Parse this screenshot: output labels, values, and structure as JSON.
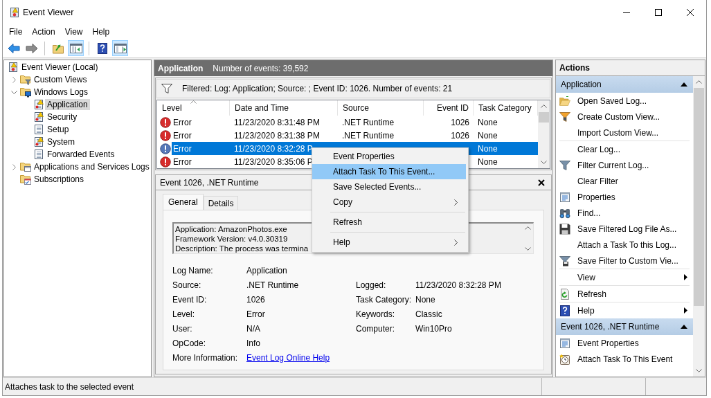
{
  "window": {
    "title": "Event Viewer"
  },
  "menu_bar": [
    "File",
    "Action",
    "View",
    "Help"
  ],
  "toolbar": [
    [
      {
        "kind": "back",
        "disabled": false,
        "pressed": false
      },
      {
        "kind": "forward",
        "disabled": true,
        "pressed": false
      }
    ],
    [
      {
        "kind": "up",
        "disabled": false,
        "pressed": false
      },
      {
        "kind": "console_tree",
        "disabled": false,
        "pressed": true
      }
    ],
    [
      {
        "kind": "help",
        "disabled": false,
        "pressed": false
      },
      {
        "kind": "action_pane",
        "disabled": false,
        "pressed": true
      }
    ]
  ],
  "console_tree": [
    {
      "label": "Event Viewer (Local)",
      "kind": "root",
      "selected": false,
      "children": [
        {
          "label": "Custom Views",
          "kind": "filter_folder",
          "expanded": false,
          "selected": false
        },
        {
          "label": "Windows Logs",
          "kind": "windows_folder",
          "expanded": true,
          "selected": false,
          "children": [
            {
              "label": "Application",
              "kind": "log_warning",
              "selected": true
            },
            {
              "label": "Security",
              "kind": "log_warning",
              "selected": false
            },
            {
              "label": "Setup",
              "kind": "log",
              "selected": false
            },
            {
              "label": "System",
              "kind": "log_warning",
              "selected": false
            },
            {
              "label": "Forwarded Events",
              "kind": "log",
              "selected": false
            }
          ]
        },
        {
          "label": "Applications and Services Logs",
          "kind": "folder",
          "expanded": false,
          "selected": false
        },
        {
          "label": "Subscriptions",
          "kind": "subscriptions",
          "selected": false
        }
      ]
    }
  ],
  "log_header": {
    "title": "Application",
    "event_count": "Number of events: 39,592"
  },
  "filter_bar": {
    "text": "Filtered: Log: Application; Source: ; Event ID: 1026. Number of events: 21"
  },
  "events_table": {
    "columns": [
      {
        "label": "Level",
        "sorted": true
      },
      {
        "label": "Date and Time",
        "sorted": false
      },
      {
        "label": "Source",
        "sorted": false
      },
      {
        "label": "Event ID",
        "sorted": false
      },
      {
        "label": "Task Category",
        "sorted": false
      }
    ],
    "rows": [
      {
        "kind": "error",
        "level": "Error",
        "date_time": "11/23/2020 8:31:48 PM",
        "source": ".NET Runtime",
        "event_id": "1026",
        "task_category": "None",
        "selected": false
      },
      {
        "kind": "error",
        "level": "Error",
        "date_time": "11/23/2020 8:31:38 PM",
        "source": ".NET Runtime",
        "event_id": "1026",
        "task_category": "None",
        "selected": false
      },
      {
        "kind": "error",
        "level": "Error",
        "date_time": "11/23/2020 8:32:28 P",
        "task_category": "None",
        "selected": true
      },
      {
        "kind": "error",
        "level": "Error",
        "date_time": "11/23/2020 8:35:06 P",
        "task_category": "None",
        "selected": false
      }
    ]
  },
  "event_details": {
    "title": "Event 1026, .NET Runtime",
    "tabs": [
      {
        "label": "General",
        "selected": true
      },
      {
        "label": "Details",
        "selected": false
      }
    ],
    "description": "Application: AmazonPhotos.exe\nFramework Version: v4.0.30319\nDescription: The process was termina",
    "properties": [
      {
        "left": {
          "label": "Log Name:",
          "value": "Application"
        }
      },
      {
        "left": {
          "label": "Source:",
          "value": ".NET Runtime"
        },
        "right": {
          "label": "Logged:",
          "value": "11/23/2020 8:32:28 PM"
        }
      },
      {
        "left": {
          "label": "Event ID:",
          "value": "1026"
        },
        "right": {
          "label": "Task Category:",
          "value": "None"
        }
      },
      {
        "left": {
          "label": "Level:",
          "value": "Error"
        },
        "right": {
          "label": "Keywords:",
          "value": "Classic"
        }
      },
      {
        "left": {
          "label": "User:",
          "value": "N/A"
        },
        "right": {
          "label": "Computer:",
          "value": "Win10Pro"
        }
      },
      {
        "left": {
          "label": "OpCode:",
          "value": "Info"
        }
      },
      {
        "left": {
          "label": "More Information:",
          "link": "Event Log Online Help"
        }
      }
    ]
  },
  "context_menu": {
    "groups": [
      [
        {
          "label": "Event Properties",
          "selected": false,
          "submenu": false
        },
        {
          "label": "Attach Task To This Event...",
          "selected": true,
          "submenu": false
        },
        {
          "label": "Save Selected Events...",
          "selected": false,
          "submenu": false
        },
        {
          "label": "Copy",
          "selected": false,
          "submenu": true
        }
      ],
      [
        {
          "label": "Refresh",
          "selected": false,
          "submenu": false
        }
      ],
      [
        {
          "label": "Help",
          "selected": false,
          "submenu": true
        }
      ]
    ]
  },
  "actions_pane": {
    "title": "Actions",
    "sections": [
      {
        "title": "Application",
        "expanded": true,
        "groups": [
          [
            {
              "label": "Open Saved Log...",
              "kind": "open_log",
              "submenu": false
            },
            {
              "label": "Create Custom View...",
              "kind": "create_view",
              "submenu": false
            },
            {
              "label": "Import Custom View...",
              "kind": "plain",
              "submenu": false
            }
          ],
          [
            {
              "label": "Clear Log...",
              "kind": "plain",
              "submenu": false
            },
            {
              "label": "Filter Current Log...",
              "kind": "filter",
              "submenu": false
            },
            {
              "label": "Clear Filter",
              "kind": "plain",
              "submenu": false
            },
            {
              "label": "Properties",
              "kind": "properties",
              "submenu": false
            },
            {
              "label": "Find...",
              "kind": "find",
              "submenu": false
            },
            {
              "label": "Save Filtered Log File As...",
              "kind": "save",
              "submenu": false
            },
            {
              "label": "Attach a Task To this Log...",
              "kind": "plain",
              "submenu": false
            },
            {
              "label": "Save Filter to Custom Vie...",
              "kind": "save_filter",
              "submenu": false
            }
          ],
          [
            {
              "label": "View",
              "kind": "plain",
              "submenu": true
            }
          ],
          [
            {
              "label": "Refresh",
              "kind": "refresh",
              "submenu": false
            }
          ],
          [
            {
              "label": "Help",
              "kind": "help",
              "submenu": true
            }
          ]
        ]
      },
      {
        "title": "Event 1026, .NET Runtime",
        "expanded": true,
        "groups": [
          [
            {
              "label": "Event Properties",
              "kind": "properties",
              "submenu": false
            },
            {
              "label": "Attach Task To This Event",
              "kind": "attach_task",
              "submenu": false
            }
          ]
        ]
      }
    ]
  },
  "status_bar": {
    "text": "Attaches task to the selected event"
  }
}
